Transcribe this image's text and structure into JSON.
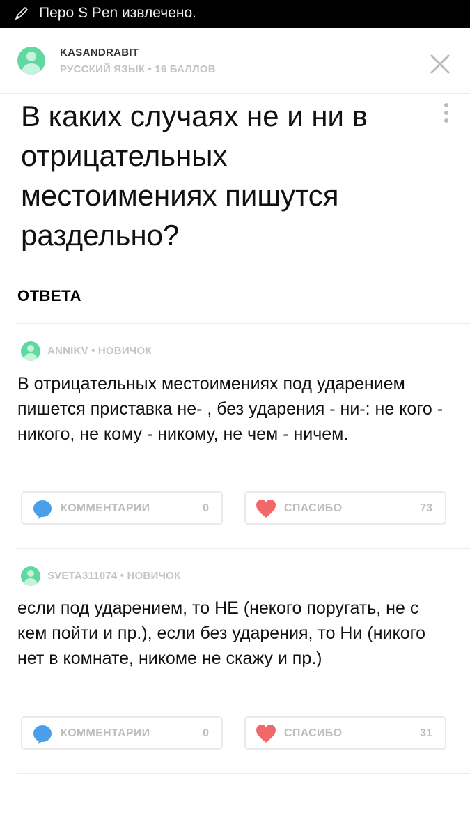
{
  "status_bar": {
    "text": "Перо S Pen извлечено."
  },
  "question": {
    "author": "KASANDRABIT",
    "meta": "РУССКИЙ ЯЗЫК • 16 БАЛЛОВ",
    "title": "В каких случаях не и ни в отрицательных местоимениях пишутся раздельно?"
  },
  "answers_heading": "ОТВЕТА",
  "answers": [
    {
      "user": "ANNIKV • НОВИЧОК",
      "text": "В отрицательных местоимениях под ударением пишется приставка не- , без ударения - ни-: не кого - никого, не кому - никому, не чем - ничем.",
      "comments_label": "КОММЕНТАРИИ",
      "comments_count": "0",
      "thanks_label": "СПАСИБО",
      "thanks_count": "73"
    },
    {
      "user": "SVETA311074 • НОВИЧОК",
      "text": "если под ударением, то НЕ (некого поругать, не с кем пойти и пр.), если без ударения, то Ни (никого нет в комнате, никоме не скажу и пр.)",
      "comments_label": "КОММЕНТАРИИ",
      "comments_count": "0",
      "thanks_label": "СПАСИБО",
      "thanks_count": "31"
    }
  ],
  "icons": {
    "status": "pen-icon",
    "avatar": "user-avatar-icon",
    "close": "close-icon",
    "menu": "more-vertical-icon",
    "comment": "comment-bubble-icon",
    "thanks": "heart-icon"
  },
  "colors": {
    "avatar": "#5fd9a0",
    "comment_icon": "#4a9fe8",
    "heart_icon": "#f26868",
    "muted_text": "#c4c4c4"
  }
}
